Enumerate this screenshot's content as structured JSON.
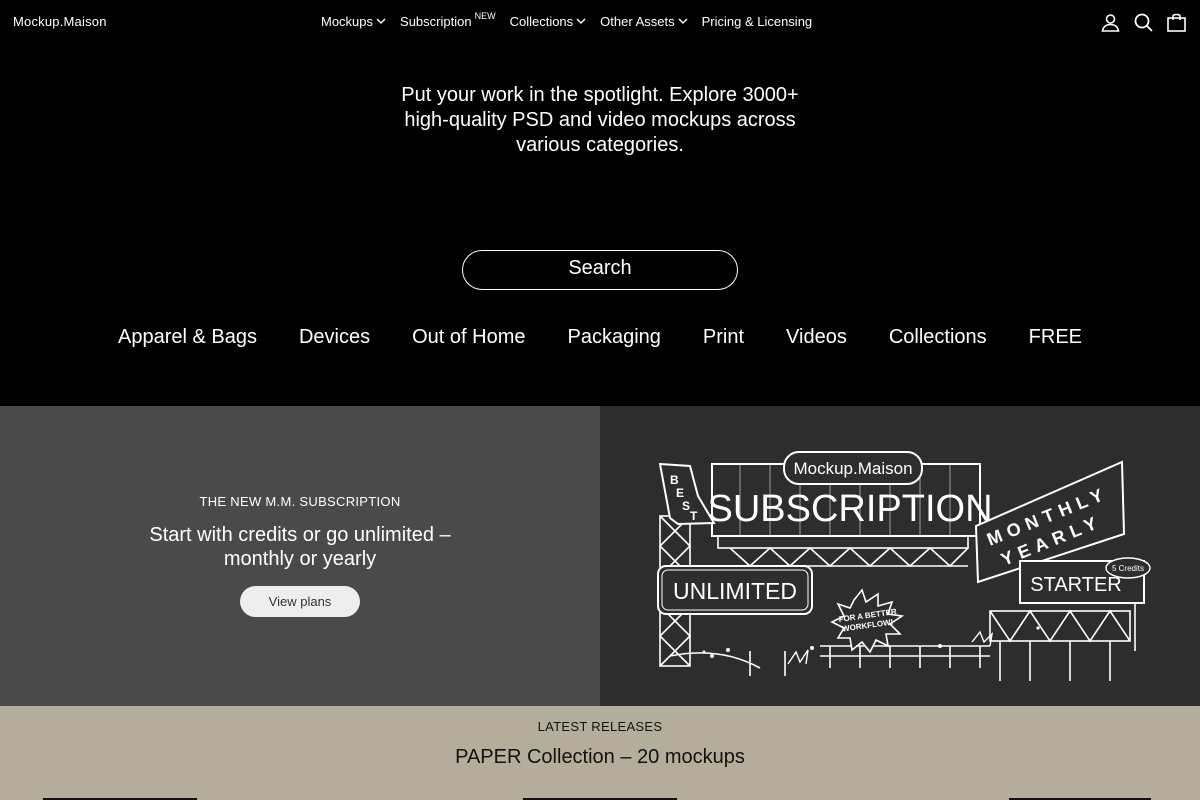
{
  "header": {
    "logo": "Mockup.Maison",
    "nav": [
      {
        "label": "Mockups",
        "dropdown": true
      },
      {
        "label": "Subscription",
        "badge": "NEW"
      },
      {
        "label": "Collections",
        "dropdown": true
      },
      {
        "label": "Other Assets",
        "dropdown": true
      },
      {
        "label": "Pricing & Licensing"
      }
    ],
    "icons": [
      "account-icon",
      "search-icon",
      "cart-icon"
    ]
  },
  "hero": {
    "tagline": "Put your work in the spotlight. Explore 3000+ high-quality PSD and video mockups across various categories.",
    "search_label": "Search",
    "categories": [
      "Apparel & Bags",
      "Devices",
      "Out of Home",
      "Packaging",
      "Print",
      "Videos",
      "Collections",
      "FREE"
    ]
  },
  "subscription_banner": {
    "kicker": "THE NEW M.M. SUBSCRIPTION",
    "title": "Start with credits or go unlimited – monthly or yearly",
    "button": "View plans",
    "illustration": {
      "brand": "Mockup.Maison",
      "headline": "SUBSCRIPTION",
      "best": [
        "B",
        "E",
        "S",
        "T"
      ],
      "monthly": "MONTHLY",
      "yearly": "YEARLY",
      "unlimited": "UNLIMITED",
      "starter": "STARTER",
      "credits": "5 Credits",
      "burst_line1": "FOR A BETTER",
      "burst_line2": "WORKFLOW!"
    }
  },
  "latest": {
    "kicker": "LATEST RELEASES",
    "title": "PAPER Collection – 20 mockups"
  },
  "colors": {
    "page_bg": "#000000",
    "banner_left": "#4a4a4a",
    "banner_right": "#2d2d2d",
    "latest_bg": "#b5ad9c"
  }
}
